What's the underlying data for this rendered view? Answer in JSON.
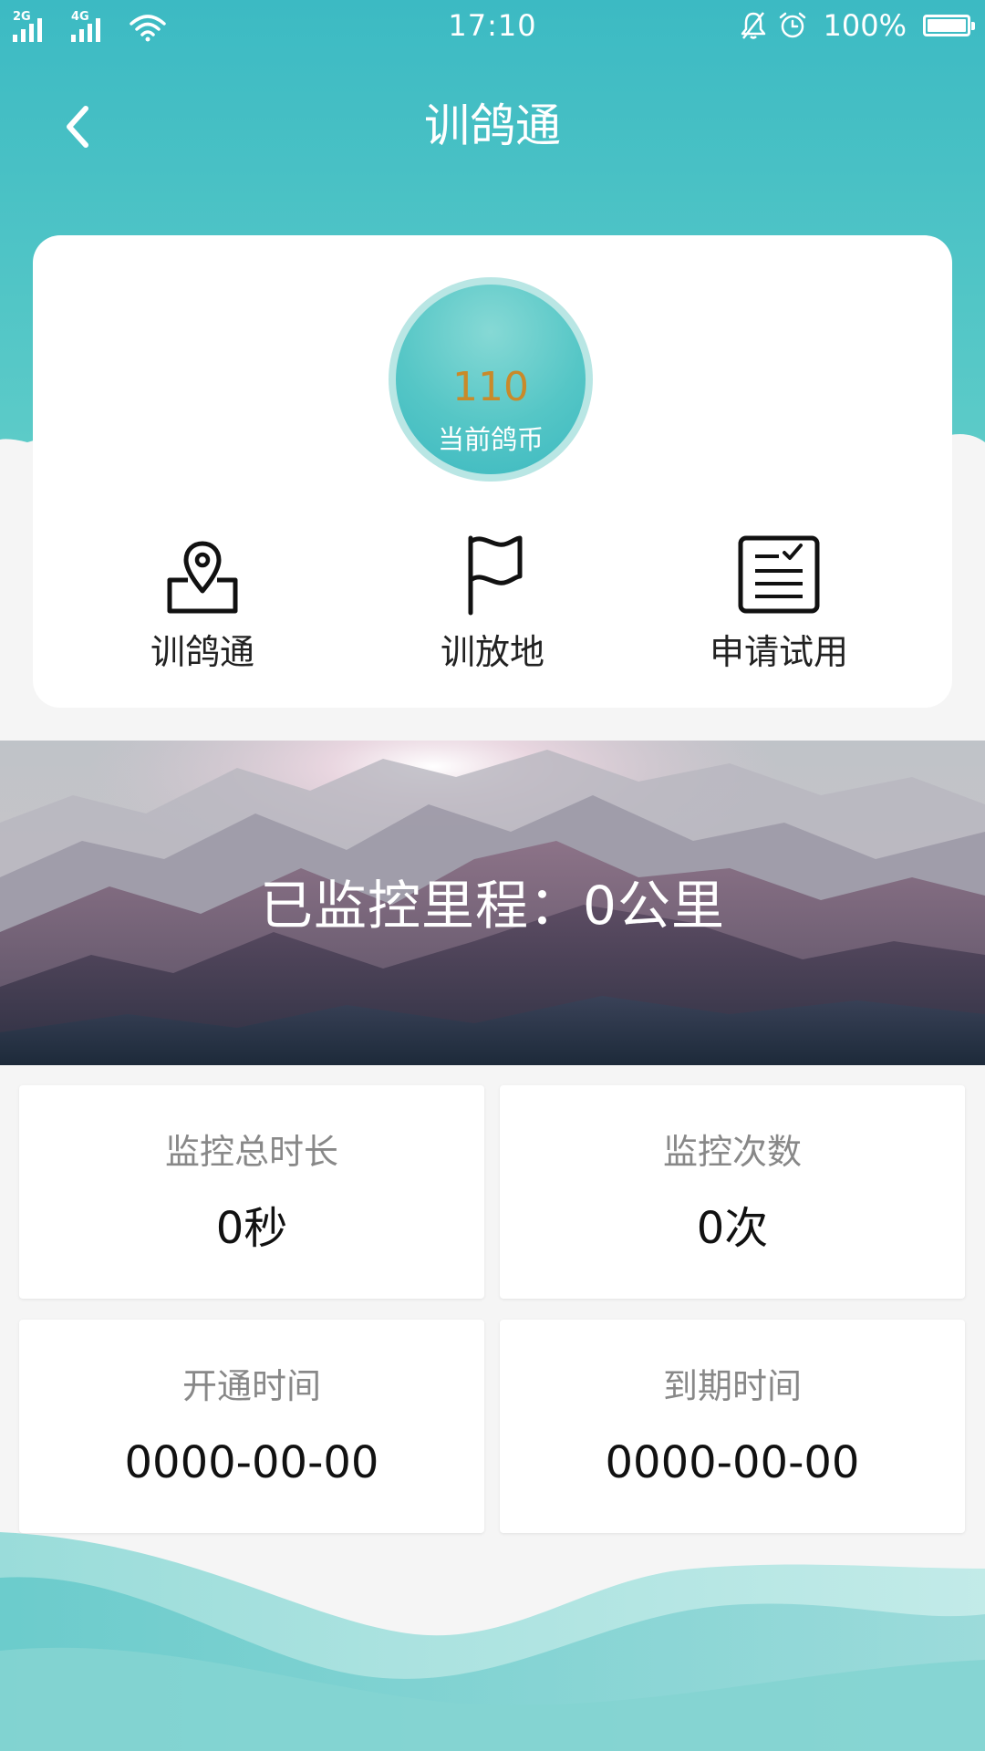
{
  "theme": {
    "primary": "#3cbac3",
    "primary_light": "#8ad8d5",
    "coin_value_color": "#c98a2a",
    "background": "#f5f5f5"
  },
  "status_bar": {
    "network_1": "2G",
    "network_2": "4G",
    "time": "17:10",
    "battery_percent": "100%",
    "icons": [
      "signal-icon",
      "signal-icon",
      "wifi-icon",
      "mute-bell-icon",
      "alarm-icon",
      "battery-icon"
    ]
  },
  "nav": {
    "title": "训鸽通",
    "back_icon": "chevron-left-icon"
  },
  "coin": {
    "value": "110",
    "label": "当前鸽币"
  },
  "menu": [
    {
      "label": "训鸽通",
      "icon": "map-pin-icon"
    },
    {
      "label": "训放地",
      "icon": "flag-icon"
    },
    {
      "label": "申请试用",
      "icon": "document-check-icon"
    }
  ],
  "banner": {
    "text": "已监控里程：0公里"
  },
  "stats": [
    {
      "label": "监控总时长",
      "value": "0秒"
    },
    {
      "label": "监控次数",
      "value": "0次"
    },
    {
      "label": "开通时间",
      "value": "0000-00-00"
    },
    {
      "label": "到期时间",
      "value": "0000-00-00"
    }
  ]
}
